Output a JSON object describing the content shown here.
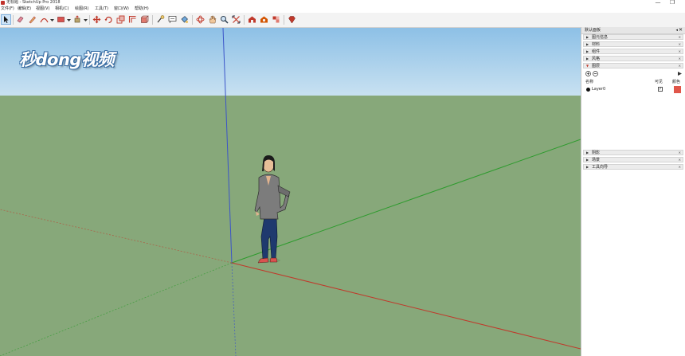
{
  "window": {
    "title": "无标题 - SketchUp Pro 2018",
    "minimize": "—",
    "restore": "❐"
  },
  "menu": {
    "items": [
      "文件(F)",
      "编辑(E)",
      "视图(V)",
      "相机(C)",
      "绘图(R)",
      "工具(T)",
      "窗口(W)",
      "帮助(H)"
    ]
  },
  "toolbar": {
    "tools": [
      "select-tool",
      "eraser-tool",
      "line-tool",
      "arc-tool",
      "shape-tool",
      "pushpull-tool",
      "move-tool",
      "rotate-tool",
      "scale-tool",
      "offset-tool",
      "tape-measure-tool",
      "text-tool",
      "paint-bucket-tool",
      "orbit-tool",
      "pan-tool",
      "zoom-tool",
      "zoom-extents-tool",
      "warehouse-tool",
      "extension-warehouse-tool",
      "component-tool",
      "ruby-tool"
    ],
    "selected": "select-tool"
  },
  "watermark": {
    "text": "秒dong视频"
  },
  "tray": {
    "title": "默认面板",
    "pin": "◂",
    "close": "✕",
    "sections_top": [
      {
        "label": "图元信息",
        "close": "✕"
      },
      {
        "label": "材料",
        "close": "✕"
      },
      {
        "label": "组件",
        "close": "✕"
      },
      {
        "label": "风格",
        "close": "✕"
      },
      {
        "label": "图层",
        "close": "✕"
      }
    ],
    "layers": {
      "col_name": "名称",
      "col_visible": "可见",
      "col_color": "颜色",
      "rows": [
        {
          "name": "Layer0",
          "visible": "✓",
          "color": "#e0564a"
        }
      ]
    },
    "sections_bottom": [
      {
        "label": "阴影",
        "close": "✕"
      },
      {
        "label": "场景",
        "close": "✕"
      },
      {
        "label": "工具向导",
        "close": "✕"
      }
    ]
  },
  "colors": {
    "sky": "#a9cfe9",
    "ground": "#87a87a",
    "axis_red": "#c0392b",
    "axis_green": "#2e9b2e",
    "axis_blue": "#3b54c8",
    "toolbar_bg": "#f3f3f3"
  }
}
